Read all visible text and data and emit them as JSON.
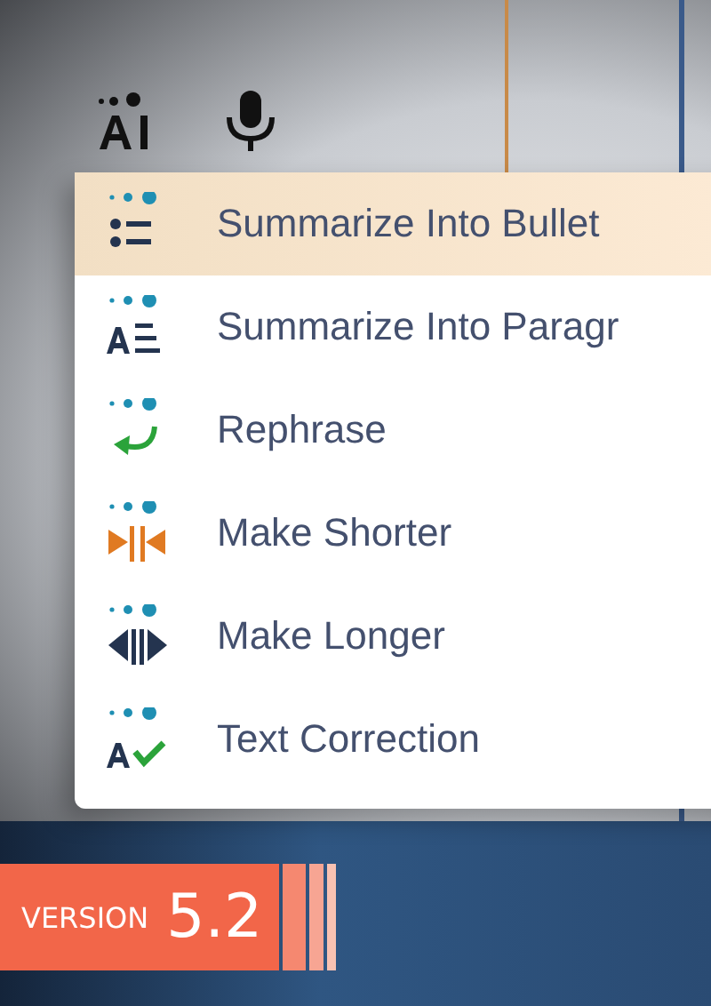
{
  "toolbar": {
    "buttons": [
      {
        "kind": "ai"
      },
      {
        "kind": "mic"
      }
    ]
  },
  "menu": {
    "items": [
      {
        "kind": "bullets",
        "label": "Summarize Into Bullet",
        "selected": true
      },
      {
        "kind": "paragraph",
        "label": "Summarize Into Paragr",
        "selected": false
      },
      {
        "kind": "rephrase",
        "label": "Rephrase",
        "selected": false
      },
      {
        "kind": "shorter",
        "label": "Make Shorter",
        "selected": false
      },
      {
        "kind": "longer",
        "label": "Make Longer",
        "selected": false
      },
      {
        "kind": "correction",
        "label": "Text Correction",
        "selected": false
      }
    ]
  },
  "banner": {
    "prefix": "VERSION",
    "version": "5.2"
  }
}
